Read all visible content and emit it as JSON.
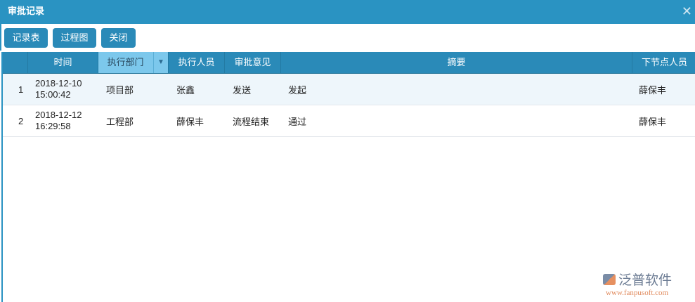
{
  "window": {
    "title": "审批记录"
  },
  "toolbar": {
    "buttons": [
      "记录表",
      "过程图",
      "关闭"
    ]
  },
  "table": {
    "columns": [
      "时间",
      "执行部门",
      "执行人员",
      "审批意见",
      "摘要",
      "下节点人员"
    ],
    "rows": [
      {
        "index": "1",
        "date": "2018-12-10",
        "time": "15:00:42",
        "dept": "项目部",
        "person": "张鑫",
        "opinion": "发送",
        "summary": "发起",
        "next": "薛保丰"
      },
      {
        "index": "2",
        "date": "2018-12-12",
        "time": "16:29:58",
        "dept": "工程部",
        "person": "薛保丰",
        "opinion": "流程结束",
        "summary": "通过",
        "next": "薛保丰"
      }
    ]
  },
  "watermark": {
    "name": "泛普软件",
    "url": "www.fanpusoft.com"
  }
}
